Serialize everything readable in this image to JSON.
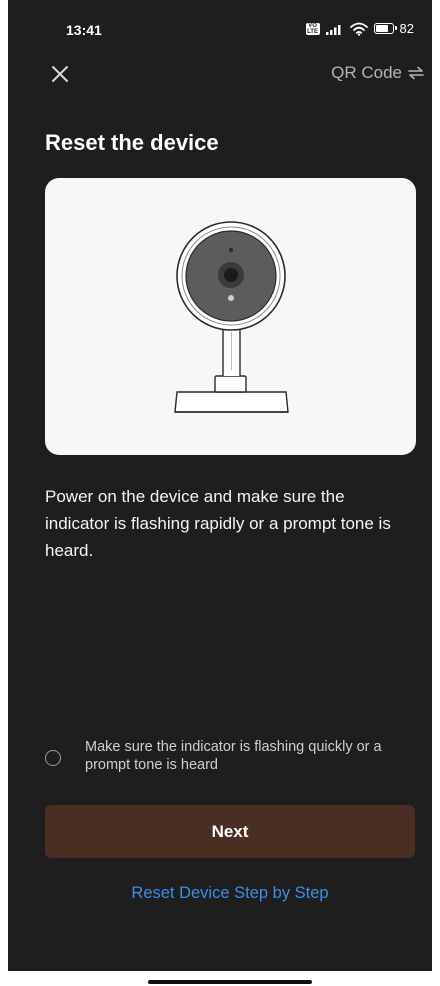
{
  "status_bar": {
    "time": "13:41",
    "battery_percent": "82",
    "battery_level": 0.82,
    "network_badge": "VoLTE"
  },
  "header": {
    "close_icon": "close-icon",
    "qr_label": "QR Code",
    "qr_icon": "swap-arrows-icon"
  },
  "page": {
    "title": "Reset the device",
    "illustration": "indoor-camera-illustration",
    "instruction": "Power on the device and make sure the indicator is flashing rapidly or a prompt tone is heard."
  },
  "confirm": {
    "checked": false,
    "label": "Make sure the indicator is flashing quickly or a prompt tone is heard"
  },
  "actions": {
    "next_label": "Next",
    "step_link_label": "Reset Device Step by Step"
  },
  "colors": {
    "background": "#1e1e1e",
    "card": "#f7f7f7",
    "next_button": "#4a2e24",
    "link": "#3d8ee8"
  }
}
